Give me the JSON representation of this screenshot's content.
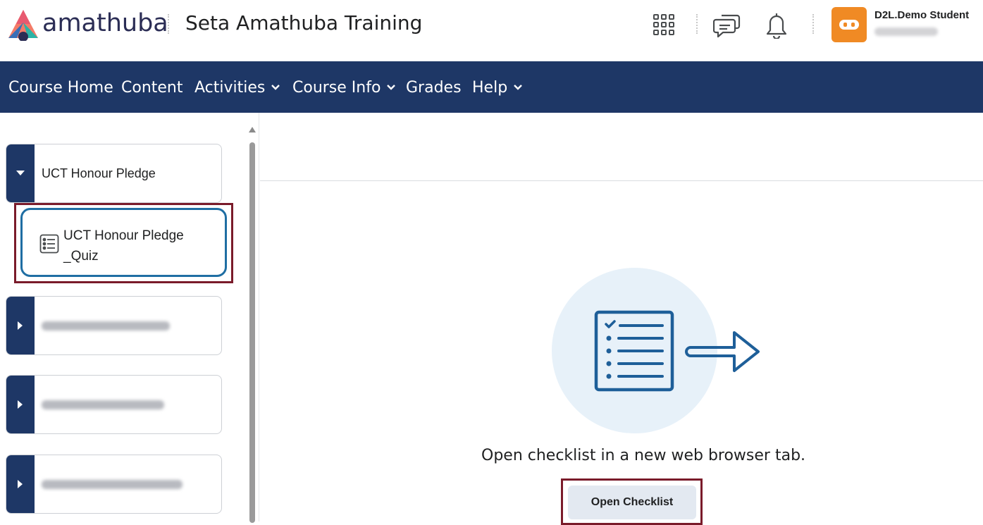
{
  "header": {
    "logo_text": "amathuba",
    "course_title": "Seta Amathuba Training",
    "icons": [
      "waffle-grid-icon",
      "message-alerts-icon",
      "notification-bell-icon"
    ],
    "user": {
      "name": "D2L.Demo Student",
      "avatar_icon": "mask-icon",
      "avatar_color": "#f08a24"
    }
  },
  "nav": {
    "items": [
      {
        "label": "Course Home",
        "dropdown": false
      },
      {
        "label": "Content",
        "dropdown": false
      },
      {
        "label": "Activities",
        "dropdown": true
      },
      {
        "label": "Course Info",
        "dropdown": true
      },
      {
        "label": "Grades",
        "dropdown": false
      },
      {
        "label": "Help",
        "dropdown": true
      }
    ],
    "bg_color": "#1e3766"
  },
  "sidebar": {
    "units": [
      {
        "label": "UCT Honour Pledge",
        "expanded": true
      },
      {
        "label": "",
        "expanded": false
      },
      {
        "label": "",
        "expanded": false
      },
      {
        "label": "",
        "expanded": false
      }
    ],
    "selected_item": {
      "label_line1": "UCT Honour Pledge",
      "label_line2": "_Quiz",
      "icon": "quiz-list-icon"
    }
  },
  "main": {
    "prompt": "Open checklist in a new web browser tab.",
    "button_label": "Open Checklist",
    "illustration_icon": "checklist-open-external-icon"
  },
  "colors": {
    "highlight": "#7a1b2a",
    "selected_border": "#1f6ea3",
    "accent": "#1e3766"
  }
}
